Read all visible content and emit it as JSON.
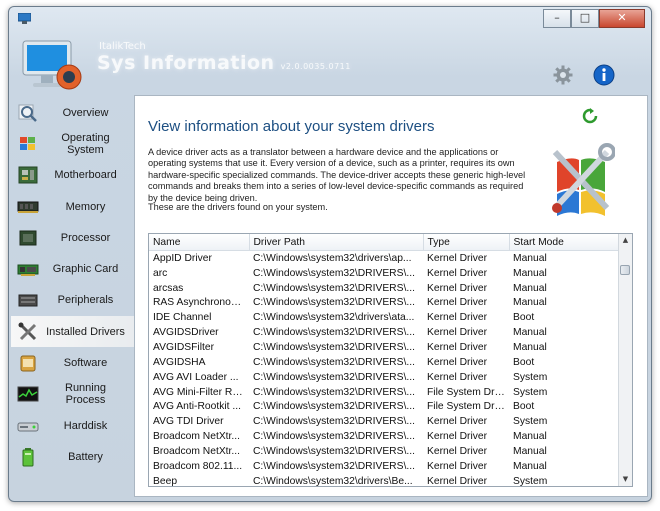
{
  "window": {
    "brand_sub": "ItalikTech",
    "brand_title": "Sys Information",
    "brand_version": "v2.0.0035.0711",
    "controls": {
      "minimize": "–",
      "maximize": "□",
      "close": "✕"
    }
  },
  "sidebar": {
    "items": [
      {
        "label": "Overview",
        "icon": "magnifier-icon",
        "active": false
      },
      {
        "label": "Operating System",
        "icon": "windows-logo-icon",
        "active": false
      },
      {
        "label": "Motherboard",
        "icon": "motherboard-icon",
        "active": false
      },
      {
        "label": "Memory",
        "icon": "memory-icon",
        "active": false
      },
      {
        "label": "Processor",
        "icon": "processor-icon",
        "active": false
      },
      {
        "label": "Graphic Card",
        "icon": "graphic-card-icon",
        "active": false
      },
      {
        "label": "Peripherals",
        "icon": "peripherals-icon",
        "active": false
      },
      {
        "label": "Installed Drivers",
        "icon": "tools-icon",
        "active": true
      },
      {
        "label": "Software",
        "icon": "software-icon",
        "active": false
      },
      {
        "label": "Running Process",
        "icon": "process-monitor-icon",
        "active": false
      },
      {
        "label": "Harddisk",
        "icon": "harddisk-icon",
        "active": false
      },
      {
        "label": "Battery",
        "icon": "battery-icon",
        "active": false
      }
    ]
  },
  "main": {
    "heading": "View information about your system drivers",
    "description": "A device driver acts as a translator between a hardware device and the applications or operating systems that use it. Every version of a device, such as a printer, requires its own hardware-specific specialized commands. The device-driver accepts these generic high-level commands and breaks them into a series of low-level device-specific commands as required by the device being driven.",
    "found_text": "These are the drivers found on your system.",
    "table": {
      "columns": [
        "Name",
        "Driver Path",
        "Type",
        "Start Mode"
      ],
      "rows": [
        [
          "AppID Driver",
          "C:\\Windows\\system32\\drivers\\ap...",
          "Kernel Driver",
          "Manual"
        ],
        [
          "arc",
          "C:\\Windows\\system32\\DRIVERS\\...",
          "Kernel Driver",
          "Manual"
        ],
        [
          "arcsas",
          "C:\\Windows\\system32\\DRIVERS\\...",
          "Kernel Driver",
          "Manual"
        ],
        [
          "RAS Asynchronou...",
          "C:\\Windows\\system32\\DRIVERS\\...",
          "Kernel Driver",
          "Manual"
        ],
        [
          "IDE Channel",
          "C:\\Windows\\system32\\drivers\\ata...",
          "Kernel Driver",
          "Boot"
        ],
        [
          "AVGIDSDriver",
          "C:\\Windows\\system32\\DRIVERS\\...",
          "Kernel Driver",
          "Manual"
        ],
        [
          "AVGIDSFilter",
          "C:\\Windows\\system32\\DRIVERS\\...",
          "Kernel Driver",
          "Manual"
        ],
        [
          "AVGIDSHA",
          "C:\\Windows\\system32\\DRIVERS\\...",
          "Kernel Driver",
          "Boot"
        ],
        [
          "AVG AVI Loader ...",
          "C:\\Windows\\system32\\DRIVERS\\...",
          "Kernel Driver",
          "System"
        ],
        [
          "AVG Mini-Filter Re...",
          "C:\\Windows\\system32\\DRIVERS\\...",
          "File System Dri...",
          "System"
        ],
        [
          "AVG Anti-Rootkit ...",
          "C:\\Windows\\system32\\DRIVERS\\...",
          "File System Dri...",
          "Boot"
        ],
        [
          "AVG TDI Driver",
          "C:\\Windows\\system32\\DRIVERS\\...",
          "Kernel Driver",
          "System"
        ],
        [
          "Broadcom NetXtr...",
          "C:\\Windows\\system32\\DRIVERS\\...",
          "Kernel Driver",
          "Manual"
        ],
        [
          "Broadcom NetXtr...",
          "C:\\Windows\\system32\\DRIVERS\\...",
          "Kernel Driver",
          "Manual"
        ],
        [
          "Broadcom 802.11...",
          "C:\\Windows\\system32\\DRIVERS\\...",
          "Kernel Driver",
          "Manual"
        ],
        [
          "Beep",
          "C:\\Windows\\system32\\drivers\\Be...",
          "Kernel Driver",
          "System"
        ]
      ]
    }
  }
}
